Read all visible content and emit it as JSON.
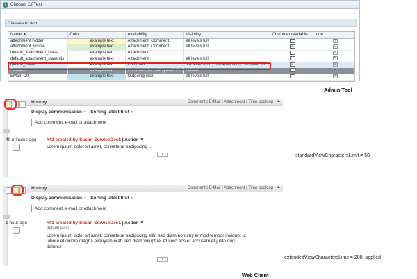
{
  "admin": {
    "window_title": "Classes Of Text",
    "section_title": "Classes of text",
    "columns": [
      "Name ▲",
      "Color",
      "Availability",
      "Visibility",
      "Customer readable",
      "Icon"
    ],
    "rows": [
      {
        "name": "attachment hidden",
        "color_text": "example text",
        "color": "#fbf7c0",
        "availability": "Attachment, Comment",
        "visibility": "all levels full",
        "readable": "",
        "icon": "?"
      },
      {
        "name": "attachment_visible",
        "color_text": "example text",
        "color": "#d9f0cf",
        "availability": "Attachment, Comment",
        "visibility": "all levels full",
        "readable": "✓",
        "icon": "✓"
      },
      {
        "name": "default_attachment_class",
        "color_text": "example text",
        "color": "#ffffff",
        "availability": "Attachment",
        "visibility": "",
        "readable": "",
        "icon": "✎"
      },
      {
        "name": "default_attachment_class (1)",
        "color_text": "example text",
        "color": "#ffffff",
        "availability": "Attachment",
        "visibility": "all levels full",
        "readable": "",
        "icon": "✎"
      },
      {
        "name": "default_class",
        "color_text": "example text",
        "color": "#ffffff",
        "availability": "Comment",
        "visibility": "1st level short, 2nd level short, 3rd level full",
        "readable": "✓",
        "icon": "✉"
      },
      {
        "name": "Deleted",
        "color_text": "example text",
        "color": "#8a8f96",
        "availability": "Comment, Incoming mail, Ou...",
        "visibility": "hidden",
        "readable": "",
        "icon": "✕"
      },
      {
        "name": "EMail_OUT",
        "color_text": "example text",
        "color": "#bfe3f2",
        "availability": "Outgoing mail",
        "visibility": "all levels full",
        "readable": "",
        "icon": "✉"
      }
    ],
    "caption": "Admin Tool"
  },
  "client": {
    "history_title": "History",
    "tab_links": "Comment | E-Mail | Attachment | Time booking",
    "collapse_symbol": "▲",
    "display_label": "Display communication",
    "sorting_label": "Sorting latest first",
    "dropdown_arrow": "▼",
    "comment_placeholder": "Add comment, e-mail or attachment",
    "expander_symbol": "▾",
    "panel1": {
      "time": "49 minutes ago",
      "entry_by": "#43 created by Susan ServiceDesk",
      "entry_action": "| Action ▼",
      "body": "Lorem ipsum dolor sit amet, consetetur sadipscing ...",
      "note": "standardViewCharactersLimit = 50"
    },
    "panel2": {
      "time": "1 hour ago",
      "entry_by": "#43 created by Susan ServiceDesk",
      "entry_action": "| Action ▼",
      "subtitle": "default class",
      "body": "Lorem ipsum dolor sit amet, consetetur sadipscing elitr, sed diam nonumy eirmod tempor invidunt ut labore et dolore magna aliquyam erat, sed diam voluptua. At vero eos et accusam et justo duo dolores",
      "ellipsis": "...",
      "note": "extendedViewCharactersLimit = 200, applied"
    },
    "caption": "Web Client"
  },
  "icons": {
    "info": "info-icon",
    "note_tool": "note-icon",
    "entry": "comment-icon"
  },
  "colors": {
    "highlight": "#e02020",
    "author_link": "#b5382a"
  }
}
